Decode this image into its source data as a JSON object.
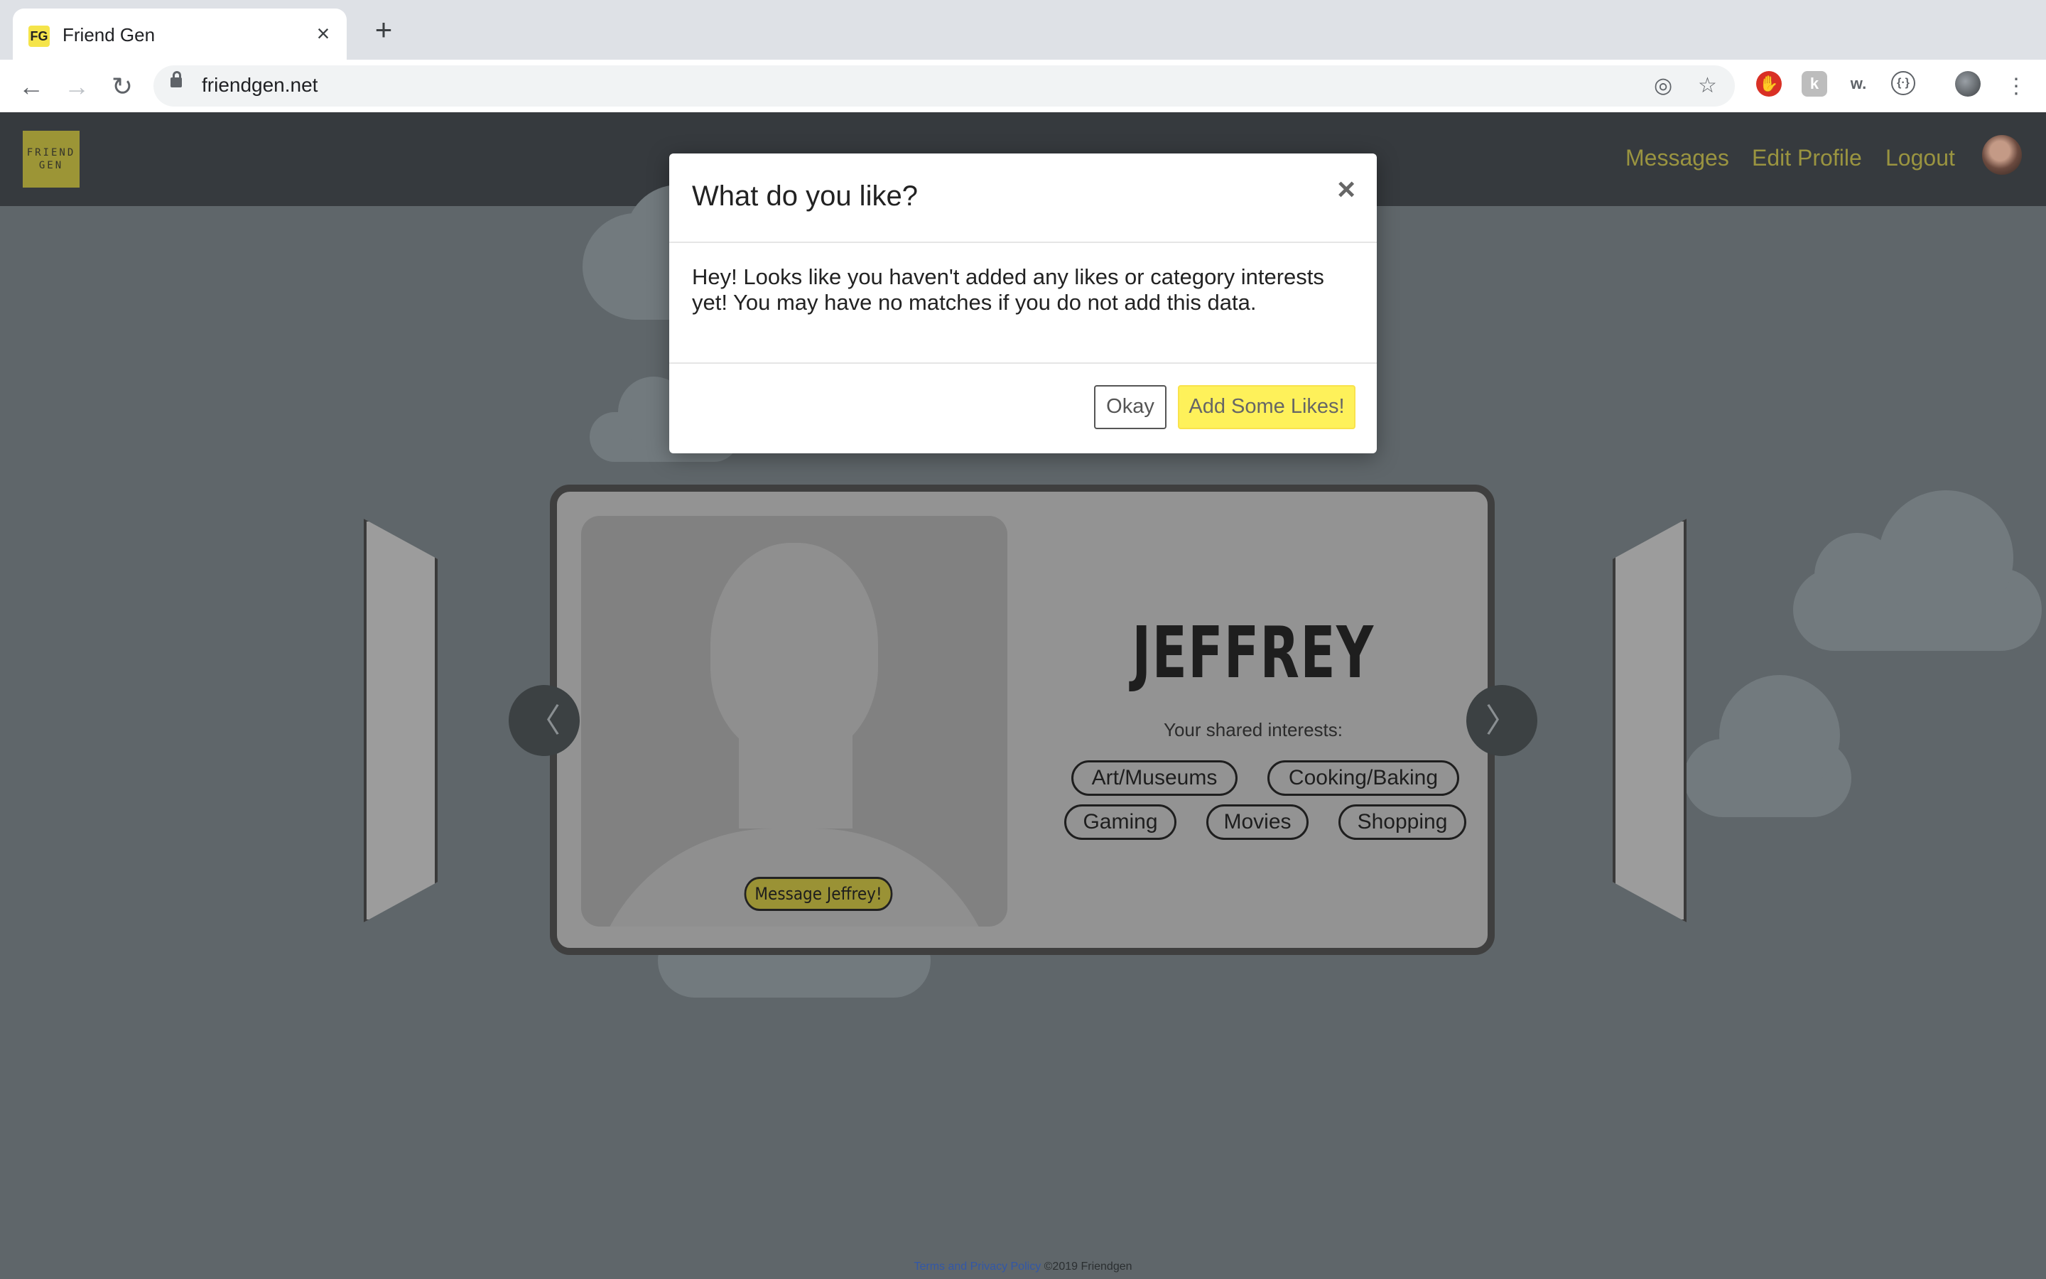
{
  "browser": {
    "tab_title": "Friend Gen",
    "favicon_text": "FG",
    "tab_close": "×",
    "new_tab": "+",
    "url": "friendgen.net"
  },
  "header": {
    "logo_line1": "FRIEND",
    "logo_line2": "GEN",
    "nav": {
      "messages": "Messages",
      "edit_profile": "Edit Profile",
      "logout": "Logout"
    }
  },
  "profile": {
    "name": "JEFFREY",
    "shared_label": "Your shared interests:",
    "interests": [
      "Art/Museums",
      "Cooking/Baking",
      "Gaming",
      "Movies",
      "Shopping"
    ],
    "message_button": "Message Jeffrey!"
  },
  "carousel": {
    "prev": "〈",
    "next": "〉"
  },
  "modal": {
    "title": "What do you like?",
    "close": "×",
    "body": "Hey! Looks like you haven't added any likes or category interests yet! You may have no matches if you do not add this data.",
    "okay_button": "Okay",
    "likes_button": "Add Some Likes!"
  },
  "footer": {
    "terms_link": "Terms and Privacy Policy",
    "copyright": "©2019 Friendgen"
  },
  "colors": {
    "page_bg": "#5f666a",
    "header_bg": "#363a3e",
    "nav_link": "#9a9440",
    "likes_button": "#fef15a"
  }
}
